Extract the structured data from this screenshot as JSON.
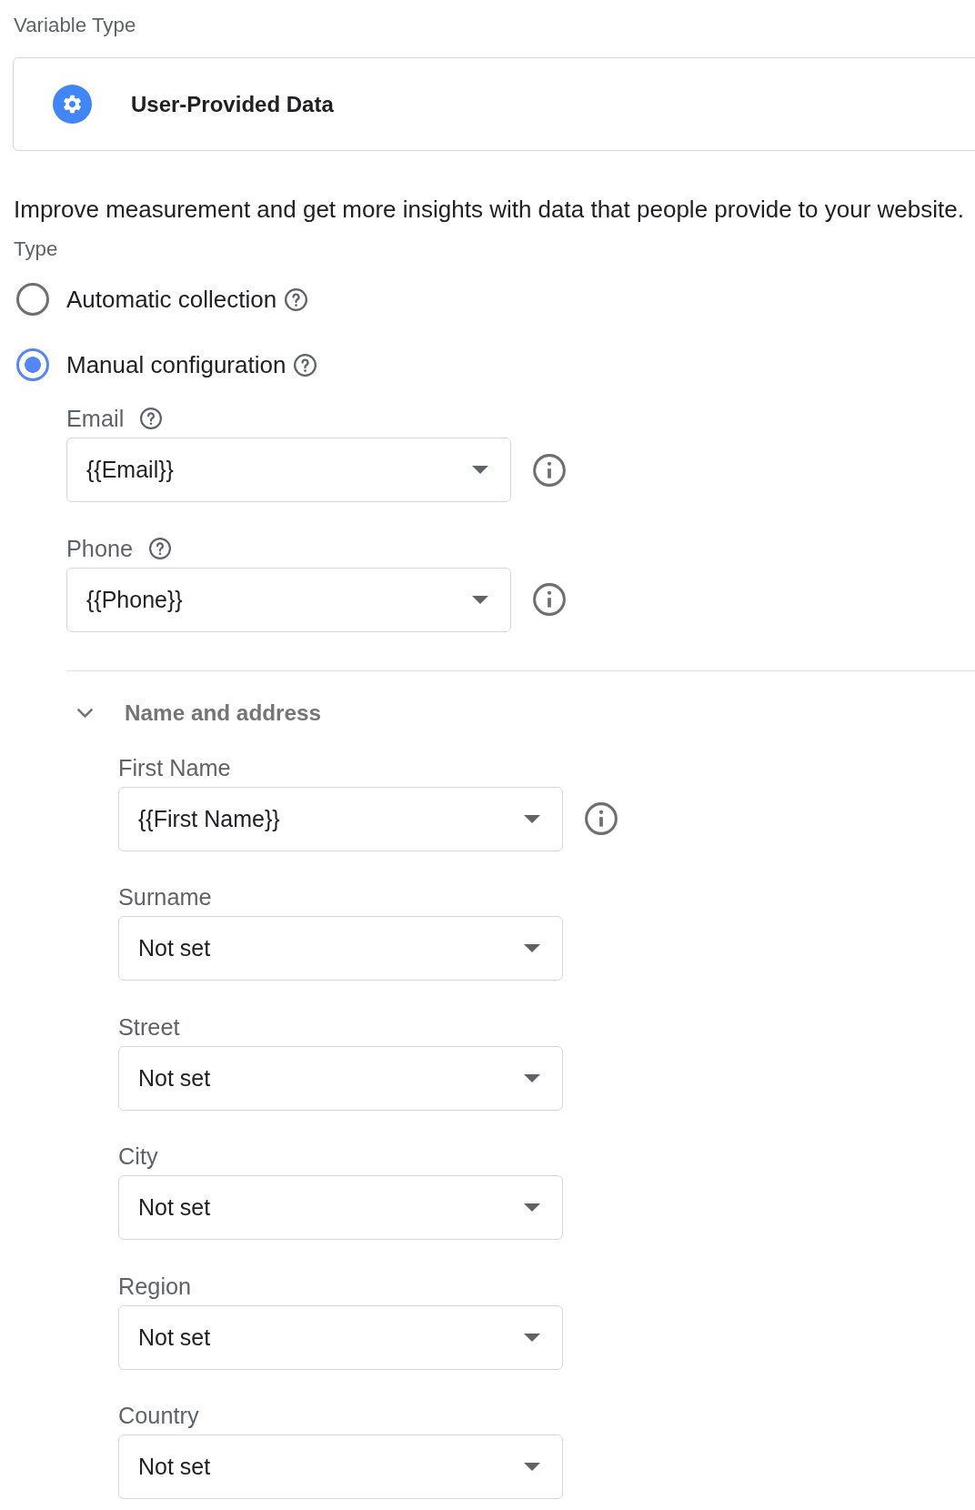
{
  "variable_type": {
    "label": "Variable Type",
    "card": {
      "title": "User-Provided Data"
    }
  },
  "description": "Improve measurement and get more insights with data that people provide to your website.",
  "type_group": {
    "label": "Type",
    "options": [
      {
        "label": "Automatic collection",
        "selected": false,
        "help": true
      },
      {
        "label": "Manual configuration",
        "selected": true,
        "help": true,
        "fields": [
          {
            "label": "Email",
            "help": true,
            "value": "{{Email}}",
            "info": true
          },
          {
            "label": "Phone",
            "help": true,
            "value": "{{Phone}}",
            "info": true
          }
        ],
        "section": {
          "title": "Name and address",
          "expanded": true,
          "fields": [
            {
              "label": "First Name",
              "help": false,
              "value": "{{First Name}}",
              "info": true
            },
            {
              "label": "Surname",
              "help": false,
              "value": "Not set",
              "info": false
            },
            {
              "label": "Street",
              "help": false,
              "value": "Not set",
              "info": false
            },
            {
              "label": "City",
              "help": false,
              "value": "Not set",
              "info": false
            },
            {
              "label": "Region",
              "help": false,
              "value": "Not set",
              "info": false
            },
            {
              "label": "Country",
              "help": false,
              "value": "Not set",
              "info": false
            }
          ]
        }
      }
    ]
  }
}
